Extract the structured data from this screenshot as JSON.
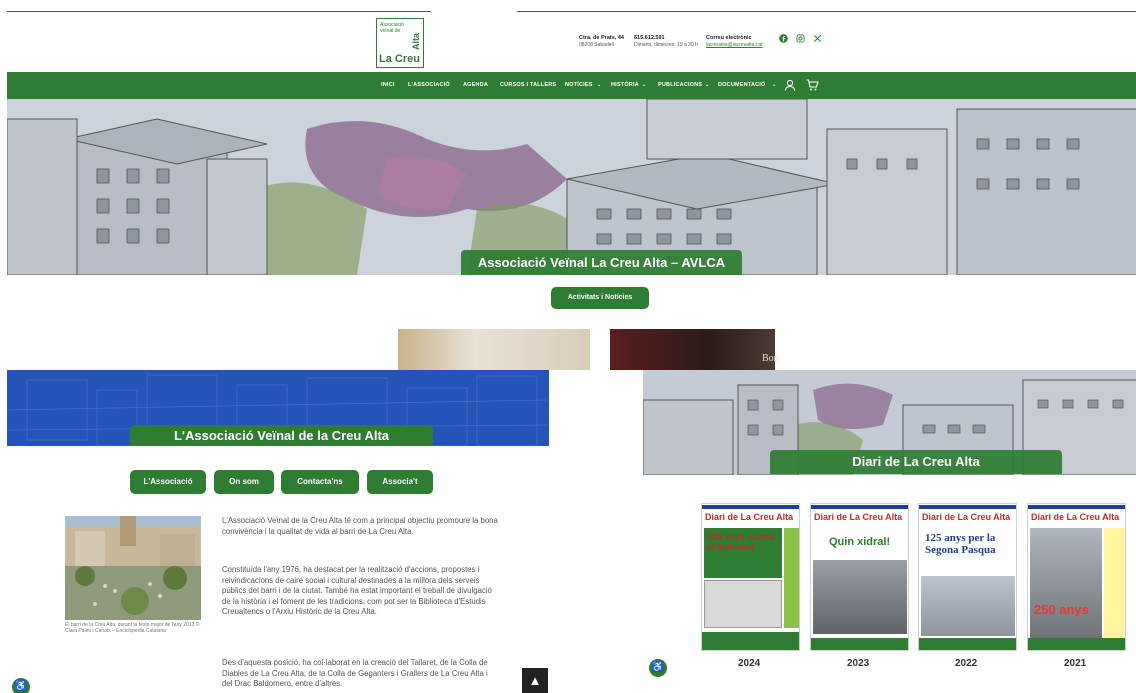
{
  "header": {
    "logo": {
      "small": "Associació veïnal de",
      "alta": "Alta",
      "creu": "La Creu"
    },
    "address": {
      "title": "Ctra. de Prats, 44",
      "line": "08208 Sabadell"
    },
    "phone": {
      "title": "615.612.591",
      "line": "Dimarts, dimecres: 19 a 20 h"
    },
    "email": {
      "title": "Correu electrònic",
      "line": "lacreualta@lacreualta.cat"
    }
  },
  "nav": {
    "items": [
      "INICI",
      "L'ASSOCIACIÓ",
      "AGENDA",
      "CURSOS I TALLERS",
      "NOTÍCIES",
      "HISTÒRIA",
      "PUBLICACIONS",
      "DOCUMENTACIÓ"
    ]
  },
  "hero": {
    "title": "Associació Veïnal La Creu Alta – AVLCA",
    "button": "Activitats i Notícies"
  },
  "peek": {
    "text": "Bon"
  },
  "assoc": {
    "title": "L'Associació Veïnal de la Creu Alta",
    "buttons": [
      "L'Associació",
      "On som",
      "Contacta'ns",
      "Associa't"
    ],
    "paragraphs": [
      "L'Associació Veïnal de la Creu Alta té com a principal objectiu promoure la bona convivència i la qualitat de vida al barri de La Creu Alta.",
      "Constituïda l'any 1976, ha destacat per la realització d'accions, propostes i reivindicacions de caire social i cultural destinades a la millora dels serveis públics del barri i de la ciutat. També ha estat important el treball de divulgació de la història i el foment de les tradicions, com pot ser la Biblioteca d'Estudis Creualtencs o l'Arxiu Històric de la Creu Alta.",
      "Des d'aquesta posició, ha col·laborat en la creació del Tallaret, de la Colla de Diables de La Creu Alta, de la Colla de Geganters i Grallers de La Creu Alta i del Drac Baldomero, entre d'altres."
    ],
    "caption": "El barri de la Creu Alta, durant la festa major de l'any 2013 © Clara Paleu i Canals – Enciclopèdia Catalana"
  },
  "diari": {
    "title": "Diari de La Creu Alta",
    "masthead": "Diari de La Creu Alta",
    "covers": [
      {
        "year": "2024",
        "headline": "125 anys contra el Sabadell"
      },
      {
        "year": "2023",
        "headline": "Quin xidral!"
      },
      {
        "year": "2022",
        "headline": "125 anys per la Segona Pasqua"
      },
      {
        "year": "2021",
        "headline": "250 anys"
      }
    ]
  },
  "icons": {
    "scroll_top": "▲",
    "access": "♿"
  },
  "colors": {
    "brand_green": "#2e7d32",
    "banner_blue": "#2553b7",
    "masthead_red": "#c62828"
  }
}
